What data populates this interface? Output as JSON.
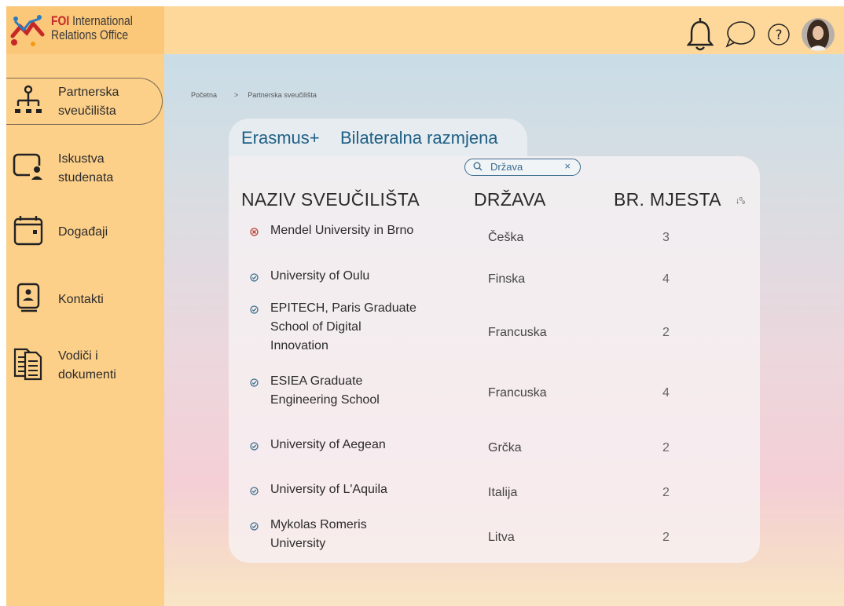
{
  "app": {
    "logo_brand": "FOI",
    "logo_line1": "International",
    "logo_line2": "Relations Office"
  },
  "topbar": {
    "icons": [
      "bell-icon",
      "chat-icon",
      "help-icon",
      "user-avatar"
    ]
  },
  "sidebar": {
    "items": [
      {
        "label_line1": "Partnerska",
        "label_line2": "sveučilišta",
        "icon": "org-chart-icon",
        "active": true
      },
      {
        "label_line1": "Iskustva",
        "label_line2": "studenata",
        "icon": "student-screen-icon",
        "active": false
      },
      {
        "label_line1": "Događaji",
        "label_line2": "",
        "icon": "calendar-icon",
        "active": false
      },
      {
        "label_line1": "Kontakti",
        "label_line2": "",
        "icon": "contact-book-icon",
        "active": false
      },
      {
        "label_line1": "Vodiči i",
        "label_line2": "dokumenti",
        "icon": "documents-icon",
        "active": false
      }
    ]
  },
  "breadcrumb": {
    "home": "Početna",
    "separator": ">",
    "current": "Partnerska sveučilišta"
  },
  "tabs": [
    {
      "label": "Erasmus+",
      "active": true
    },
    {
      "label": "Bilateralna razmjena",
      "active": false
    }
  ],
  "filter": {
    "label": "Država",
    "clear": "×"
  },
  "table": {
    "headers": [
      "NAZIV SVEUČILIŠTA",
      "DRŽAVA",
      "BR. MJESTA"
    ],
    "sort_icon": "↓⁰₉",
    "rows": [
      {
        "status": "unavailable",
        "name_lines": [
          "Mendel University in Brno"
        ],
        "country": "Češka",
        "places": "3"
      },
      {
        "status": "available",
        "name_lines": [
          "University of Oulu"
        ],
        "country": "Finska",
        "places": "4"
      },
      {
        "status": "available",
        "name_lines": [
          "EPITECH, Paris Graduate",
          "School of Digital",
          "Innovation"
        ],
        "country": "Francuska",
        "places": "2"
      },
      {
        "status": "available",
        "name_lines": [
          "ESIEA Graduate",
          "Engineering School"
        ],
        "country": "Francuska",
        "places": "4"
      },
      {
        "status": "available",
        "name_lines": [
          "University of Aegean"
        ],
        "country": "Grčka",
        "places": "2"
      },
      {
        "status": "available",
        "name_lines": [
          "University of L'Aquila"
        ],
        "country": "Italija",
        "places": "2"
      },
      {
        "status": "available",
        "name_lines": [
          "Mykolas Romeris",
          "University"
        ],
        "country": "Litva",
        "places": "2"
      }
    ]
  },
  "colors": {
    "sidebar_bg": "#fdd08a",
    "topbar_bg": "#fdd89a",
    "logo_bg": "#fbc779",
    "tab_accent": "#1f5f86",
    "unavailable": "#c0392b",
    "available": "#3a6d8e"
  }
}
